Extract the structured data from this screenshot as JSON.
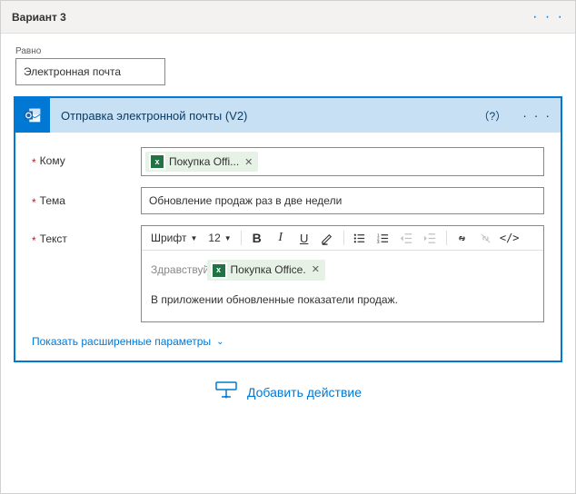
{
  "case": {
    "title": "Вариант 3",
    "more_glyph": "· · ·"
  },
  "condition": {
    "label": "Равно",
    "value": "Электронная почта"
  },
  "action": {
    "title": "Отправка электронной почты (V2)",
    "help_glyph": "（?）",
    "more_glyph": "· · ·",
    "fields": {
      "to_label": "Кому",
      "subject_label": "Тема",
      "body_label": "Текст",
      "subject_value": "Обновление продаж раз в две недели"
    },
    "chips": {
      "to": {
        "label": "Покупка Offi..."
      },
      "body": {
        "label": "Покупка Office."
      }
    },
    "editor": {
      "font_label": "Шрифт",
      "size_label": "12",
      "greeting": "Здравствуйте,",
      "body_text": "В приложении обновленные показатели продаж."
    },
    "advanced_link": "Показать расширенные параметры"
  },
  "footer": {
    "add_action_label": "Добавить действие"
  }
}
